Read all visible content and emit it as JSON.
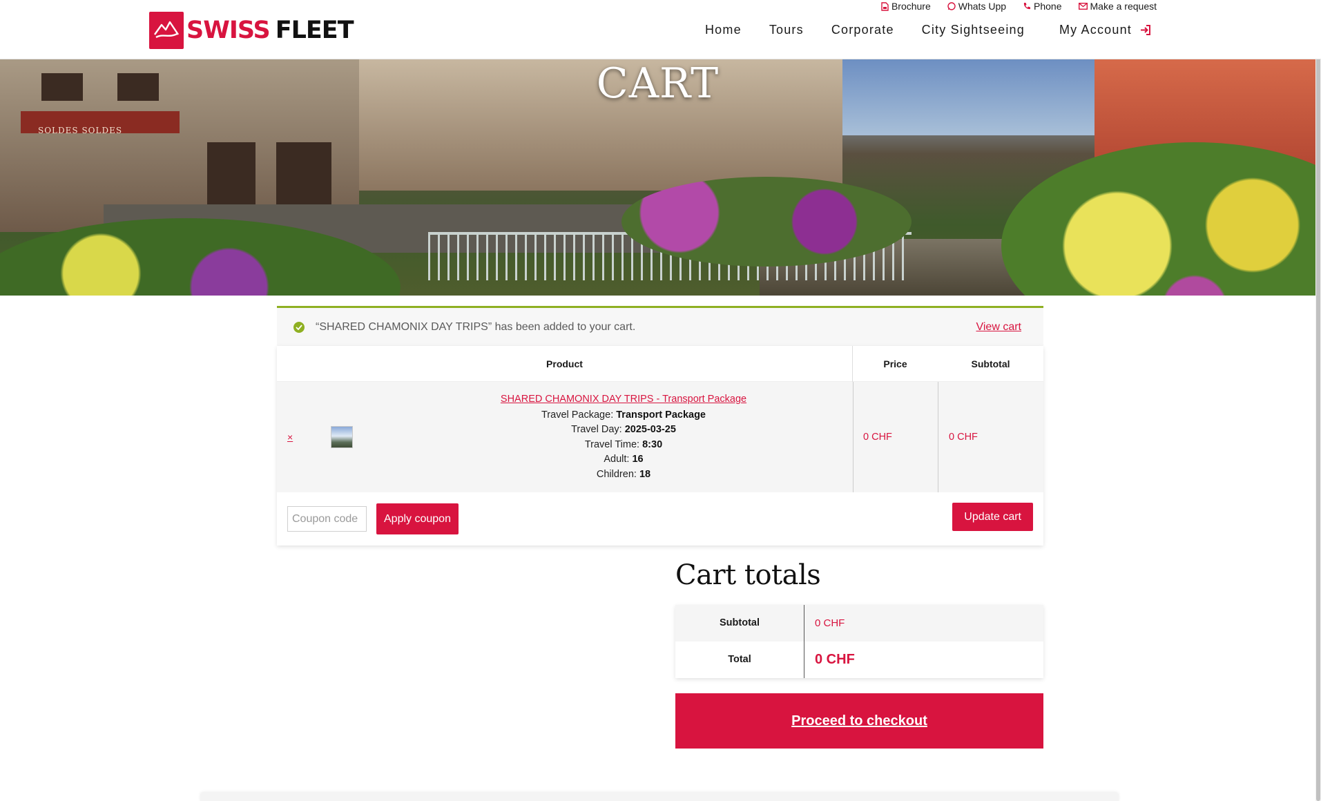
{
  "brand": {
    "swiss": "SWISS",
    "fleet": "FLEET",
    "accent": "#d8143f"
  },
  "topbar": [
    {
      "label": "Brochure",
      "icon": "file-icon"
    },
    {
      "label": "Whats Upp",
      "icon": "whatsapp-icon"
    },
    {
      "label": "Phone",
      "icon": "phone-icon"
    },
    {
      "label": "Make a request",
      "icon": "envelope-icon"
    }
  ],
  "nav": {
    "items": [
      "Home",
      "Tours",
      "Corporate",
      "City Sightseeing"
    ],
    "account": "My Account"
  },
  "hero": {
    "title": "CART",
    "awning_text": "SOLDES  SOLDES"
  },
  "notice": {
    "message": "“SHARED CHAMONIX DAY TRIPS” has been added to your cart.",
    "view_cart": "View cart",
    "color": "#8fb022"
  },
  "cart": {
    "headers": {
      "product": "Product",
      "price": "Price",
      "subtotal": "Subtotal"
    },
    "items": [
      {
        "remove": "×",
        "name": "SHARED CHAMONIX DAY TRIPS - Transport Package",
        "meta": [
          {
            "label": "Travel Package:",
            "value": "Transport Package"
          },
          {
            "label": "Travel Day:",
            "value": "2025-03-25"
          },
          {
            "label": "Travel Time:",
            "value": "8:30"
          },
          {
            "label": "Adult:",
            "value": "16"
          },
          {
            "label": "Children:",
            "value": "18"
          }
        ],
        "price": "0 CHF",
        "subtotal": "0 CHF"
      }
    ],
    "coupon_placeholder": "Coupon code",
    "apply_coupon": "Apply coupon",
    "update_cart": "Update cart"
  },
  "totals": {
    "title": "Cart totals",
    "subtotal_label": "Subtotal",
    "subtotal_value": "0 CHF",
    "total_label": "Total",
    "total_value": "0 CHF"
  },
  "checkout": {
    "label": "Proceed to checkout"
  }
}
